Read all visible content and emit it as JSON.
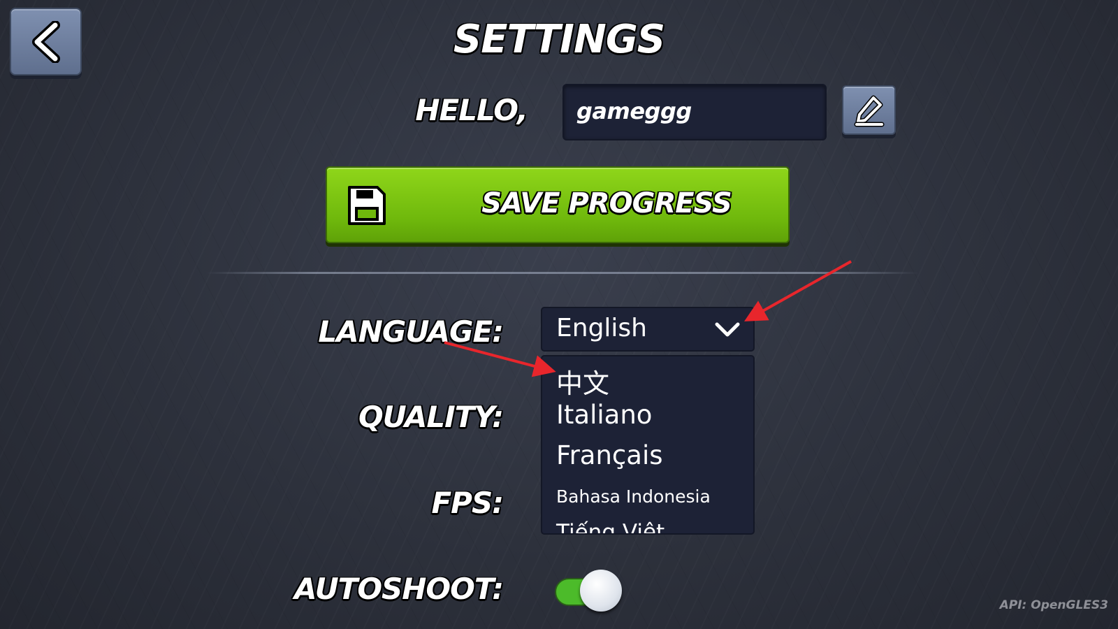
{
  "header": {
    "title": "SETTINGS",
    "back_icon": "chevron-left-icon"
  },
  "profile": {
    "hello_label": "HELLO,",
    "username": "gameggg",
    "edit_icon": "pencil-icon"
  },
  "save_button": {
    "label": "SAVE PROGRESS",
    "icon": "floppy-disk-icon"
  },
  "settings": {
    "language_label": "LANGUAGE:",
    "quality_label": "QUALITY:",
    "fps_label": "FPS:",
    "autoshoot_label": "AUTOSHOOT:"
  },
  "language": {
    "selected": "English",
    "options": [
      "中文",
      "Italiano",
      "Français",
      "Bahasa Indonesia",
      "Tiếng Việt"
    ],
    "dropdown_open": true
  },
  "autoshoot": {
    "enabled": true
  },
  "footer": {
    "api_label": "API: OpenGLES3"
  },
  "colors": {
    "background": "#2d313c",
    "button_blue": "#6f7fa0",
    "save_green": "#7cc512",
    "field_dark": "#1d2236",
    "toggle_on": "#4cbb2a",
    "annotation_arrow": "#e8262c"
  }
}
